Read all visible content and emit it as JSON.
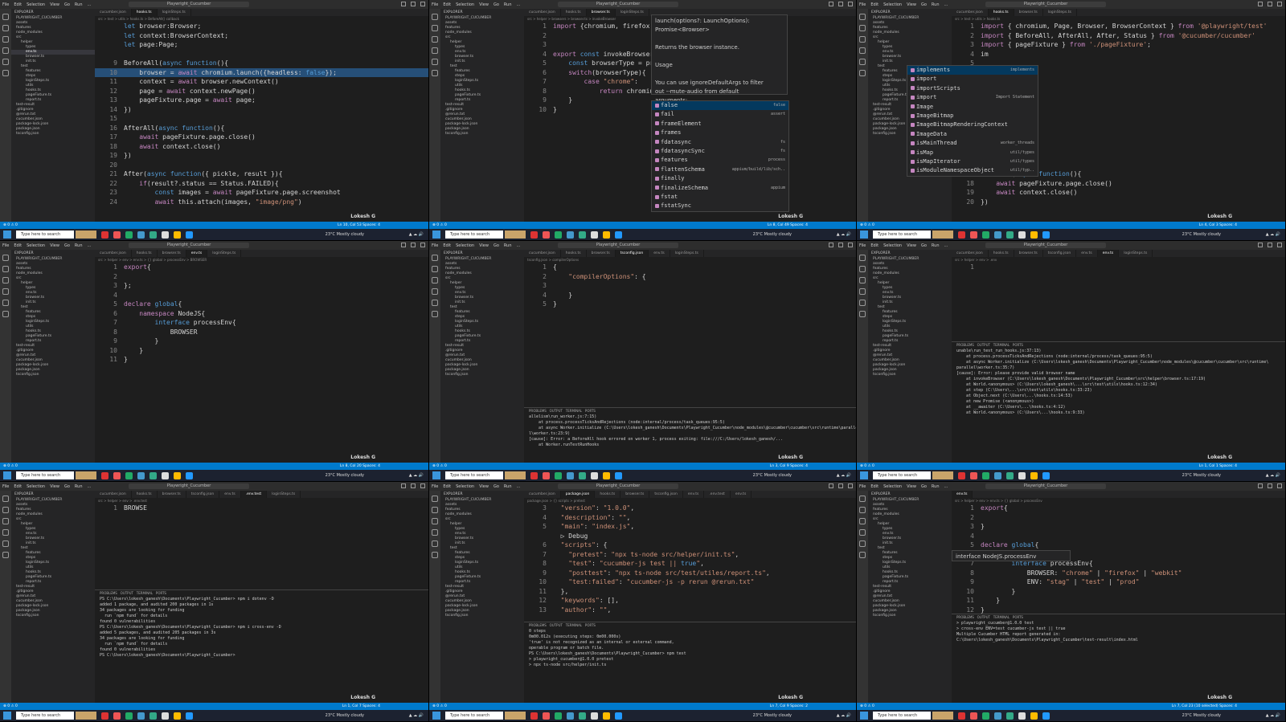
{
  "menu": [
    "File",
    "Edit",
    "Selection",
    "View",
    "Go",
    "Run",
    "..."
  ],
  "window_title": "Playwright_Cucumber",
  "search_placeholder": "Type here to search",
  "watermark": "Lokesh G",
  "weather": "23°C Mostly cloudy",
  "explorer_items": [
    "PLAYWRIGHT_CUCUMBER",
    "assets",
    "features",
    "node_modules",
    "src",
    "helper",
    "types",
    "env.ts",
    "browser.ts",
    "init.ts",
    "test",
    "features",
    "steps",
    "loginSteps.ts",
    "utils",
    "hooks.ts",
    "pageFixture.ts",
    "report.ts",
    "test-result",
    ".gitignore",
    "@rerun.txt",
    "cucumber.json",
    "package-lock.json",
    "package.json",
    "tsconfig.json"
  ],
  "panels": [
    {
      "tabs": [
        "cucumber.json",
        "hooks.ts",
        "loginSteps.ts"
      ],
      "crumb": "src > test > utils > hooks.ts > BeforeAll() callback",
      "lines": [
        {
          "n": "",
          "t": "let browser:Browser;"
        },
        {
          "n": "",
          "t": "let context:BrowserContext;"
        },
        {
          "n": "",
          "t": "let page:Page;"
        },
        {
          "n": "",
          "t": ""
        },
        {
          "n": "9",
          "t": "BeforeAll(async function(){"
        },
        {
          "n": "10",
          "t": "    browser = await chromium.launch({headless: false});",
          "hl": true
        },
        {
          "n": "11",
          "t": "    context = await browser.newContext()"
        },
        {
          "n": "12",
          "t": "    page = await context.newPage()"
        },
        {
          "n": "13",
          "t": "    pageFixture.page = await page;"
        },
        {
          "n": "14",
          "t": "})"
        },
        {
          "n": "15",
          "t": ""
        },
        {
          "n": "16",
          "t": "AfterAll(async function(){"
        },
        {
          "n": "17",
          "t": "    await pageFixture.page.close()"
        },
        {
          "n": "18",
          "t": "    await context.close()"
        },
        {
          "n": "19",
          "t": "})"
        },
        {
          "n": "20",
          "t": ""
        },
        {
          "n": "21",
          "t": "After(async function({ pickle, result }){"
        },
        {
          "n": "22",
          "t": "    if(result?.status == Status.FAILED){"
        },
        {
          "n": "23",
          "t": "        const images = await pageFixture.page.screenshot"
        },
        {
          "n": "24",
          "t": "        await this.attach(images, \"image/png\")"
        }
      ],
      "status": "Ln 10, Col 53   Spaces: 4"
    },
    {
      "tabs": [
        "cucumber.json",
        "hooks.ts",
        "browser.ts",
        "loginSteps.ts"
      ],
      "crumb": "src > helper > browsers > browser.ts > invokeBrowser",
      "lines": [
        {
          "n": "1",
          "t": "import {chromium, firefox, webkit, LaunchOptions"
        },
        {
          "n": "2",
          "t": ""
        },
        {
          "n": "3",
          "t": ""
        },
        {
          "n": "4",
          "t": "export const invokeBrowser = ()=>{"
        },
        {
          "n": "5",
          "t": "    const browserType = process.env.BROWSER;"
        },
        {
          "n": "6",
          "t": "    switch(browserType){"
        },
        {
          "n": "7",
          "t": "        case \"chrome\":"
        },
        {
          "n": "8",
          "t": "            return chromium.launch({headless: fa"
        },
        {
          "n": "9",
          "t": "    }"
        },
        {
          "n": "10",
          "t": "}"
        }
      ],
      "hover": "launch(options?: LaunchOptions):\nPromise<Browser>\n\nReturns the browser instance.\n\nUsage\n\nYou can use ignoreDefaultArgs to filter\nout --mute-audio from default\narguments:",
      "suggest": [
        {
          "label": "false",
          "detail": "false"
        },
        {
          "label": "fail",
          "detail": "assert"
        },
        {
          "label": "frameElement",
          "detail": ""
        },
        {
          "label": "frames",
          "detail": ""
        },
        {
          "label": "fdatasync",
          "detail": "fs"
        },
        {
          "label": "fdatasyncSync",
          "detail": "fs"
        },
        {
          "label": "features",
          "detail": "process"
        },
        {
          "label": "flattenSchema",
          "detail": "appium/build/lib/sch.."
        },
        {
          "label": "finally",
          "detail": ""
        },
        {
          "label": "finalizeSchema",
          "detail": "appium"
        },
        {
          "label": "fstat",
          "detail": ""
        },
        {
          "label": "fstatSync",
          "detail": ""
        }
      ],
      "status": "Ln 8, Col 49   Spaces: 4"
    },
    {
      "tabs": [
        "cucumber.json",
        "hooks.ts",
        "browser.ts",
        "loginSteps.ts"
      ],
      "crumb": "src > test > utils > hooks.ts",
      "lines": [
        {
          "n": "1",
          "t": "import { chromium, Page, Browser, BrowserContext } from '@playwright/test'"
        },
        {
          "n": "2",
          "t": "import { BeforeAll, AfterAll, After, Status } from '@cucumber/cucumber'"
        },
        {
          "n": "3",
          "t": "import { pageFixture } from './pageFixture';"
        },
        {
          "n": "4",
          "t": "im"
        },
        {
          "n": "5",
          "t": ""
        },
        {
          "n": "6",
          "t": ""
        },
        {
          "n": "7",
          "t": ""
        },
        {
          "n": "8",
          "t": ""
        },
        {
          "n": "9",
          "t": ""
        },
        {
          "n": "10",
          "t": "Be"
        },
        {
          "n": "11",
          "t": ""
        },
        {
          "n": "12",
          "t": ""
        },
        {
          "n": "13",
          "t": ""
        },
        {
          "n": "14",
          "t": ""
        },
        {
          "n": "15",
          "t": "})"
        },
        {
          "n": "16",
          "t": ""
        },
        {
          "n": "17",
          "t": "AfterAll(async function(){"
        },
        {
          "n": "18",
          "t": "    await pageFixture.page.close()"
        },
        {
          "n": "19",
          "t": "    await context.close()"
        },
        {
          "n": "20",
          "t": "})"
        }
      ],
      "suggest": [
        {
          "label": "implements",
          "detail": "implements"
        },
        {
          "label": "import",
          "detail": ""
        },
        {
          "label": "importScripts",
          "detail": ""
        },
        {
          "label": "import",
          "detail": "Import Statement"
        },
        {
          "label": "Image",
          "detail": ""
        },
        {
          "label": "ImageBitmap",
          "detail": ""
        },
        {
          "label": "ImageBitmapRenderingContext",
          "detail": ""
        },
        {
          "label": "ImageData",
          "detail": ""
        },
        {
          "label": "isMainThread",
          "detail": "worker_threads"
        },
        {
          "label": "isMap",
          "detail": "util/types"
        },
        {
          "label": "isMapIterator",
          "detail": "util/types"
        },
        {
          "label": "isModuleNamespaceObject",
          "detail": "util/typ.."
        }
      ],
      "status": "Ln 4, Col 3   Spaces: 4"
    },
    {
      "tabs": [
        "cucumber.json",
        "hooks.ts",
        "browser.ts",
        "env.ts",
        "loginSteps.ts"
      ],
      "crumb": "src > helper > env > env.ts > {} global > processEnv > BROWSER",
      "lines": [
        {
          "n": "1",
          "t": "export{"
        },
        {
          "n": "2",
          "t": ""
        },
        {
          "n": "3",
          "t": "};"
        },
        {
          "n": "4",
          "t": ""
        },
        {
          "n": "5",
          "t": "declare global{"
        },
        {
          "n": "6",
          "t": "    namespace NodeJS{"
        },
        {
          "n": "7",
          "t": "        interface processEnv{"
        },
        {
          "n": "8",
          "t": "            BROWSER"
        },
        {
          "n": "9",
          "t": "        }"
        },
        {
          "n": "10",
          "t": "    }"
        },
        {
          "n": "11",
          "t": "}"
        }
      ],
      "status": "Ln 8, Col 20   Spaces: 4"
    },
    {
      "tabs": [
        "cucumber.json",
        "hooks.ts",
        "browser.ts",
        "tsconfig.json",
        "env.ts",
        "loginSteps.ts"
      ],
      "crumb": "tsconfig.json > compilerOptions",
      "lines": [
        {
          "n": "1",
          "t": "{"
        },
        {
          "n": "2",
          "t": "    \"compilerOptions\": {"
        },
        {
          "n": "3",
          "t": "        "
        },
        {
          "n": "4",
          "t": "    }"
        },
        {
          "n": "5",
          "t": "}"
        }
      ],
      "terminal": [
        "allelism\\run_worker.js:7:15)",
        "    at process.processTicksAndRejections (node:internal/process/task_queues:95:5)",
        "    at async Worker.initialize (C:\\Users\\lokesh_ganesh\\Documents\\Playwright_Cucumber\\node_modules\\@cucumber\\cucumber\\src\\runtime\\paralle",
        "l\\worker.ts:23:9)",
        "[cause]: Error: a BeforeAll hook errored on worker 1, process exiting: file:///C:/Users/lokesh_ganesh/...",
        "    at Worker.runTestRunHooks"
      ],
      "status": "Ln 3, Col 9   Spaces: 4"
    },
    {
      "tabs": [
        "cucumber.json",
        "hooks.ts",
        "browser.ts",
        "tsconfig.json",
        "env.ts",
        "env.ts",
        "loginSteps.ts"
      ],
      "crumb": "src > helper > env > .env",
      "lines": [
        {
          "n": "1",
          "t": ""
        }
      ],
      "terminal": [
        "unable\\run_test_run_hooks.js:37:13)",
        "    at process.processTicksAndRejections (node:internal/process/task_queues:95:5)",
        "    at async Worker.initialize (C:\\Users\\lokesh_ganesh\\Documents\\Playwright_Cucumber\\node_modules\\@cucumber\\cucumber\\src\\runtime\\",
        "parallel\\worker.ts:35:7)",
        "[cause]: Error: please provide valid browser name",
        "    at invokeBrowser (C:\\Users\\lokesh_ganesh\\Documents\\Playwright_Cucumber\\src\\helper\\browser.ts:17:19)",
        "    at World.<anonymous> (C:\\Users\\lokesh_ganesh\\...\\src\\test\\utils\\hooks.ts:12:34)",
        "    at step (C:\\Users\\...\\src\\test\\utils\\hooks.ts:33:23)",
        "    at Object.next (C:\\Users\\...\\hooks.ts:14:53)",
        "    at new Promise (<anonymous>)",
        "    at __awaiter (C:\\Users\\...\\hooks.ts:4:12)",
        "    at World.<anonymous> (C:\\Users\\...\\hooks.ts:9:33)"
      ],
      "status": "Ln 1, Col 1   Spaces: 4"
    },
    {
      "tabs": [
        "cucumber.json",
        "hooks.ts",
        "browser.ts",
        "tsconfig.json",
        "env.ts",
        ".env.test",
        "loginSteps.ts"
      ],
      "crumb": "src > helper > env > .env.test",
      "lines": [
        {
          "n": "1",
          "t": "BROWSE"
        }
      ],
      "terminal": [
        "PS C:\\Users\\lokesh_ganesh\\Documents\\Playwright_Cucumber> npm i dotenv -D",
        "",
        "added 1 package, and audited 200 packages in 1s",
        "",
        "34 packages are looking for funding",
        "  run `npm fund` for details",
        "",
        "found 0 vulnerabilities",
        "PS C:\\Users\\lokesh_ganesh\\Documents\\Playwright_Cucumber> npm i cross-env -D",
        "",
        "added 5 packages, and audited 205 packages in 3s",
        "",
        "34 packages are looking for funding",
        "  run `npm fund` for details",
        "",
        "found 0 vulnerabilities",
        "PS C:\\Users\\lokesh_ganesh\\Documents\\Playwright_Cucumber> "
      ],
      "status": "Ln 1, Col 7   Spaces: 4"
    },
    {
      "tabs": [
        "cucumber.json",
        "package.json",
        "hooks.ts",
        "browser.ts",
        "tsconfig.json",
        "env.ts",
        ".env.test",
        "env.ts"
      ],
      "crumb": "package.json > {} scripts > pretest",
      "lines": [
        {
          "n": "3",
          "t": "  \"version\": \"1.0.0\","
        },
        {
          "n": "4",
          "t": "  \"description\": \"\","
        },
        {
          "n": "5",
          "t": "  \"main\": \"index.js\","
        },
        {
          "n": "",
          "t": "  ▷ Debug"
        },
        {
          "n": "6",
          "t": "  \"scripts\": {"
        },
        {
          "n": "7",
          "t": "    \"pretest\": \"npx ts-node src/helper/init.ts\","
        },
        {
          "n": "8",
          "t": "    \"test\": \"cucumber-js test || true\","
        },
        {
          "n": "9",
          "t": "    \"posttest\": \"npx ts-node src/test/utiles/report.ts\","
        },
        {
          "n": "10",
          "t": "    \"test:failed\": \"cucumber-js -p rerun @rerun.txt\""
        },
        {
          "n": "11",
          "t": "  },"
        },
        {
          "n": "12",
          "t": "  \"keywords\": [],"
        },
        {
          "n": "13",
          "t": "  \"author\": \"\","
        }
      ],
      "terminal": [
        "0 steps",
        "0m00.012s (executing steps: 0m00.000s)",
        "'true' is not recognized as an internal or external command,",
        "operable program or batch file.",
        "PS C:\\Users\\lokesh_ganesh\\Documents\\Playwright_Cucumber> npm test",
        "",
        "> playwright_cucumber@1.0.0 pretest",
        "> npx ts-node src/helper/init.ts",
        "",
        ""
      ],
      "status": "Ln 7, Col 9   Spaces: 2"
    },
    {
      "tabs": [
        "env.ts"
      ],
      "crumb": "src > helper > env > env.ts > {} global > processEnv",
      "lines": [
        {
          "n": "1",
          "t": "export{"
        },
        {
          "n": "2",
          "t": ""
        },
        {
          "n": "3",
          "t": "}"
        },
        {
          "n": "4",
          "t": ""
        },
        {
          "n": "5",
          "t": "declare global{"
        },
        {
          "n": "6",
          "t": "    namespace NodeJS{"
        },
        {
          "n": "7",
          "t": "        interface processEnv{"
        },
        {
          "n": "8",
          "t": "            BROWSER: \"chrome\" | \"firefox\" | \"webkit\""
        },
        {
          "n": "9",
          "t": "            ENV: \"stag\" | \"test\" | \"prod\""
        },
        {
          "n": "10",
          "t": "        }"
        },
        {
          "n": "11",
          "t": "    }"
        },
        {
          "n": "12",
          "t": "}"
        }
      ],
      "hover": "interface NodeJS.processEnv",
      "terminal": [
        "> playwright_cucumber@1.0.0 test",
        "> cross-env ENV=test cucumber-js test || true",
        "",
        "",
        "",
        "",
        "Multiple Cucumber HTML report generated in:",
        "",
        "C:\\Users\\lokesh_ganesh\\Documents\\Playwright_Cucumber\\test-result\\index.html"
      ],
      "status": "Ln 7, Col 23 (10 selected)   Spaces: 4"
    }
  ]
}
